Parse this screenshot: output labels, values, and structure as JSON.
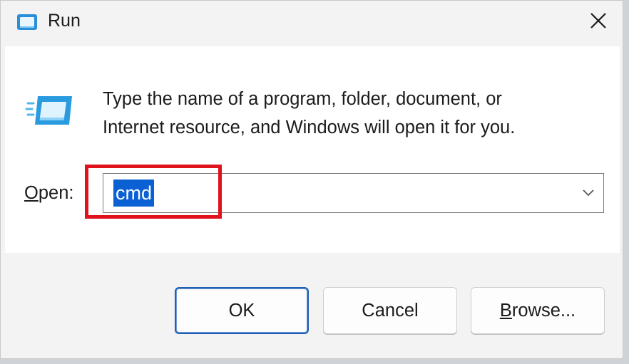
{
  "window": {
    "title": "Run"
  },
  "dialog": {
    "description_line1": "Type the name of a program, folder, document, or",
    "description_line2": "Internet resource, and Windows will open it for you.",
    "open_label_mnemonic": "O",
    "open_label_rest": "pen:",
    "open_value": "cmd"
  },
  "buttons": {
    "ok_label": "OK",
    "cancel_label": "Cancel",
    "browse_mnemonic": "B",
    "browse_rest": "rowse..."
  },
  "icons": {
    "title": "run-app-icon",
    "dialog": "run-app-icon",
    "close": "close-icon",
    "dropdown": "chevron-down-icon"
  },
  "colors": {
    "selection": "#0b61d4",
    "highlight_box": "#e0121b",
    "default_button_border": "#1f60b3"
  }
}
